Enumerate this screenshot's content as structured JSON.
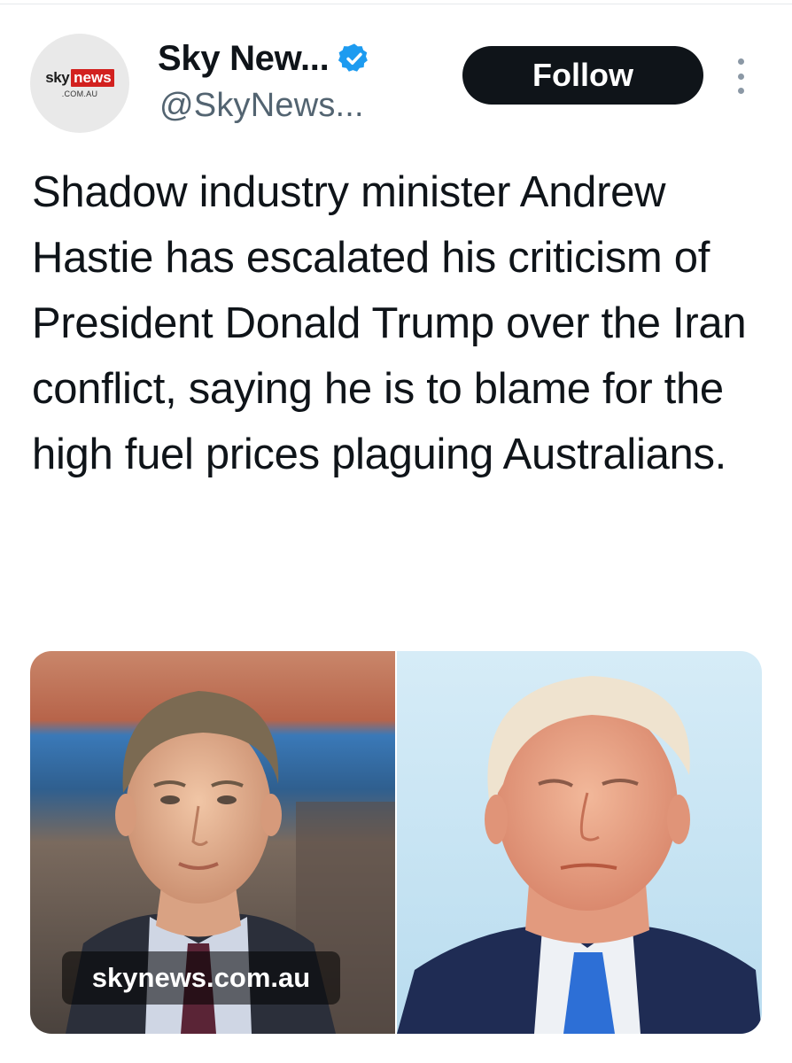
{
  "account": {
    "logo_sky": "sky",
    "logo_news": "news",
    "logo_domain": ".COM.AU",
    "display_name": "Sky New...",
    "verified_icon": "verified-badge-icon",
    "handle": "@SkyNews..."
  },
  "actions": {
    "follow_label": "Follow",
    "more_icon": "more-options-icon"
  },
  "tweet": {
    "text": "Shadow industry minister Andrew Hastie has escalated his criticism of President Donald Trump over the Iran conflict, saying he is to blame for the high fuel prices plaguing Australians."
  },
  "media": {
    "domain_label": "skynews.com.au",
    "left_photo": "man-portrait-photo",
    "right_photo": "man-portrait-photo"
  },
  "colors": {
    "verified_blue": "#1d9bf0",
    "follow_bg": "#0f1419",
    "logo_red": "#d2211f"
  }
}
